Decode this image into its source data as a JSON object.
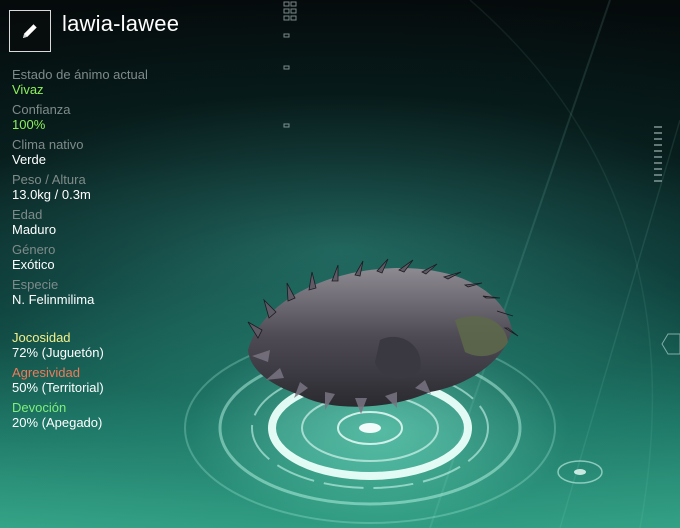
{
  "creature": {
    "name": "lawia-lawee"
  },
  "icons": {
    "edit": "pencil-icon"
  },
  "stats": [
    {
      "label": "Estado de ánimo actual",
      "value": "Vivaz",
      "highlight": true
    },
    {
      "label": "Confianza",
      "value": "100%",
      "highlight": true
    },
    {
      "label": "Clima nativo",
      "value": "Verde",
      "highlight": false
    },
    {
      "label": "Peso / Altura",
      "value": "13.0kg / 0.3m",
      "highlight": false
    },
    {
      "label": "Edad",
      "value": "Maduro",
      "highlight": false
    },
    {
      "label": "Género",
      "value": "Exótico",
      "highlight": false
    },
    {
      "label": "Especie",
      "value": "N. Felinmilima",
      "highlight": false
    }
  ],
  "traits": [
    {
      "label": "Jocosidad",
      "value": "72% (Juguetón)",
      "color": "#f4f08a"
    },
    {
      "label": "Agresividad",
      "value": "50% (Territorial)",
      "color": "#f07a5a"
    },
    {
      "label": "Devoción",
      "value": "20% (Apegado)",
      "color": "#7ff07a"
    }
  ]
}
